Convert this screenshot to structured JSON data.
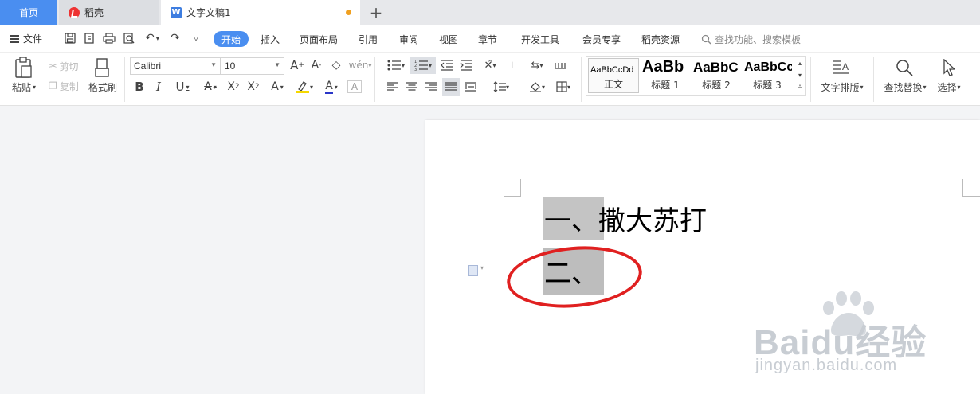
{
  "tabs": {
    "home": "首页",
    "daoke": "稻壳",
    "doc": "文字文稿1",
    "add": "+"
  },
  "menu": {
    "file": "文件",
    "items": [
      "开始",
      "插入",
      "页面布局",
      "引用",
      "审阅",
      "视图",
      "章节",
      "开发工具",
      "会员专享",
      "稻壳资源"
    ],
    "active": "开始",
    "search_placeholder": "查找功能、搜索模板"
  },
  "ribbon": {
    "paste": "粘贴",
    "cut": "剪切",
    "copy": "复制",
    "format_painter": "格式刷",
    "font_name": "Calibri",
    "font_size": "10",
    "styles": [
      {
        "sample": "AaBbCcDd",
        "name": "正文"
      },
      {
        "sample": "AaBb",
        "name": "标题 1"
      },
      {
        "sample": "AaBbC",
        "name": "标题 2"
      },
      {
        "sample": "AaBbCc",
        "name": "标题 3"
      }
    ],
    "text_layout": "文字排版",
    "find_replace": "查找替换",
    "select": "选择"
  },
  "document": {
    "line1": "一、撒大苏打",
    "line2": "二、"
  },
  "watermark": {
    "brand": "Baidu经验",
    "url": "jingyan.baidu.com"
  },
  "colors": {
    "accent": "#4a8ef0",
    "highlight": "#c4c4c4",
    "annotation": "#e02020",
    "unsaved": "#f0a020"
  }
}
